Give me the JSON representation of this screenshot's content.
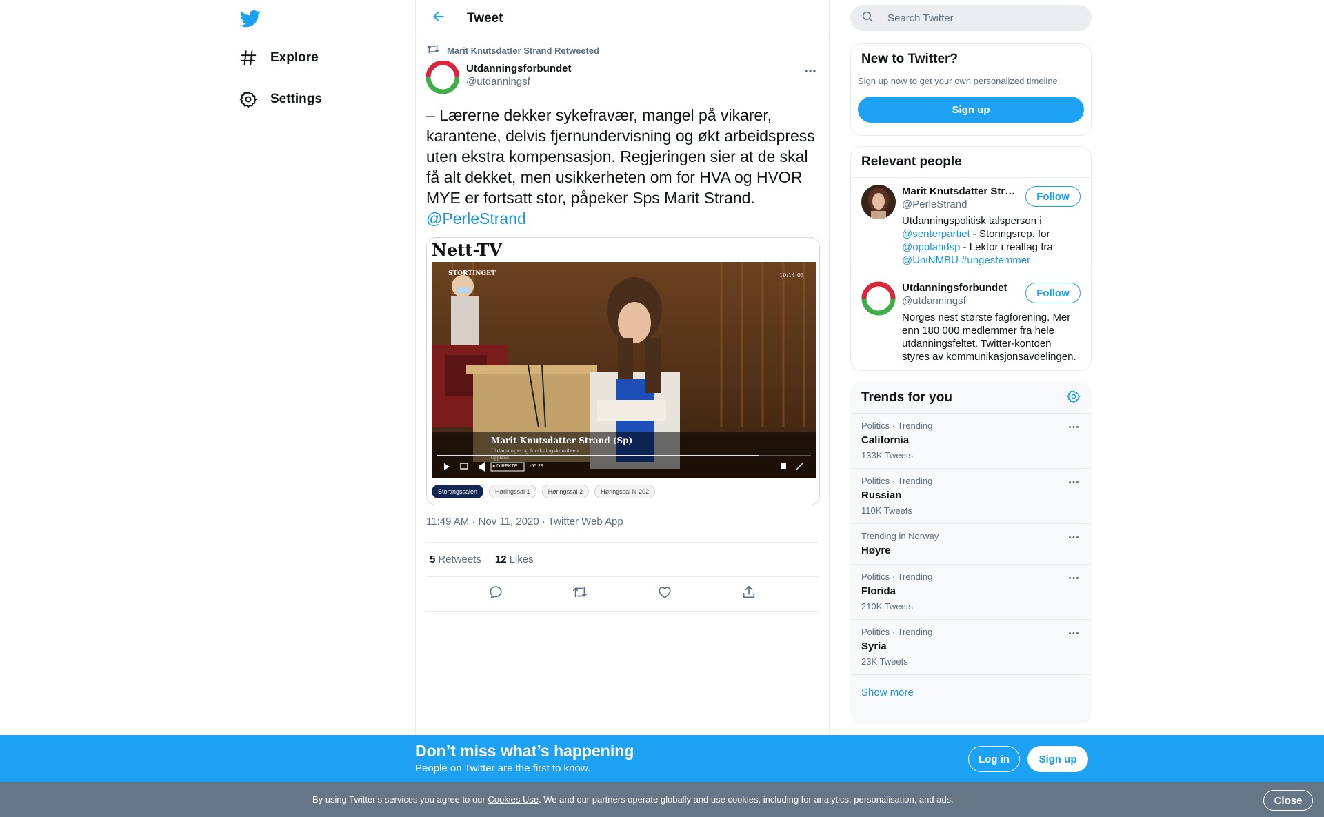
{
  "nav": {
    "logo_icon": "twitter-bird-icon",
    "items": [
      {
        "icon": "hashtag-icon",
        "label": "Explore"
      },
      {
        "icon": "gear-icon",
        "label": "Settings"
      }
    ]
  },
  "header": {
    "back_icon": "arrow-left-icon",
    "title": "Tweet"
  },
  "tweet": {
    "retweet_label": "Marit Knutsdatter Strand Retweeted",
    "author_name": "Utdanningsforbundet",
    "author_handle": "@utdanningsf",
    "text": "– Lærerne dekker sykefravær, mangel på vikarer, karantene, delvis fjernundervisning og økt arbeidspress uten ekstra kompensasjon. Regjeringen sier at de skal få alt dekket, men usikkerheten om for HVA og HVOR MYE er fortsatt stor, påpeker Sps Marit Strand.",
    "mention": "@PerleStrand",
    "media": {
      "header": "Nett-TV",
      "video_logo": "STORTINGET",
      "video_clock": "10:14:03",
      "lower_third_name": "Marit Knutsdatter Strand (Sp)",
      "lower_third_sub": "Utdannings- og forskningskomiteen",
      "lower_third_sub2": "Oppland",
      "live_label": "● DIREKTE",
      "live_time": "-55:29",
      "tabs": [
        "Stortingssalen",
        "Høringssal 1",
        "Høringssal 2",
        "Høringssal N-202"
      ]
    },
    "time": "11:49 AM · Nov 11, 2020",
    "separator": "·",
    "source": "Twitter Web App",
    "retweets_count": "5",
    "retweets_label": "Retweets",
    "likes_count": "12",
    "likes_label": "Likes"
  },
  "search": {
    "placeholder": "Search Twitter"
  },
  "new_card": {
    "title": "New to Twitter?",
    "subtitle": "Sign up now to get your own personalized timeline!",
    "signup_label": "Sign up"
  },
  "relevant": {
    "title": "Relevant people",
    "people": [
      {
        "name": "Marit Knutsdatter Strand",
        "handle": "@PerleStrand",
        "follow_label": "Follow",
        "bio_parts": [
          "Utdanningspolitisk talsperson i ",
          "@senterpartiet",
          " - Storingsrep. for ",
          "@opplandsp",
          " - Lektor i realfag fra ",
          "@UniNMBU",
          " ",
          "#ungestemmer"
        ]
      },
      {
        "name": "Utdanningsforbundet",
        "handle": "@utdanningsf",
        "follow_label": "Follow",
        "bio": "Norges nest største fagforening. Mer enn 180 000 medlemmer fra hele utdanningsfeltet. Twitter-kontoen styres av kommunikasjonsavdelingen."
      }
    ]
  },
  "trends": {
    "title": "Trends for you",
    "settings_icon": "gear-icon",
    "items": [
      {
        "context": "Politics · Trending",
        "name": "California",
        "count": "133K Tweets"
      },
      {
        "context": "Politics · Trending",
        "name": "Russian",
        "count": "110K Tweets"
      },
      {
        "context": "Trending in Norway",
        "name": "Høyre",
        "count": ""
      },
      {
        "context": "Politics · Trending",
        "name": "Florida",
        "count": "210K Tweets"
      },
      {
        "context": "Politics · Trending",
        "name": "Syria",
        "count": "23K Tweets"
      }
    ],
    "show_more": "Show more"
  },
  "promo": {
    "title": "Don’t miss what’s happening",
    "subtitle": "People on Twitter are the first to know.",
    "login_label": "Log in",
    "signup_label": "Sign up"
  },
  "cookie": {
    "text_before": "By using Twitter’s services you agree to our ",
    "link": "Cookies Use",
    "text_after": ". We and our partners operate globally and use cookies, including for analytics, personalisation, and ads.",
    "close_label": "Close"
  },
  "colors": {
    "accent": "#1da1f2",
    "link": "#1b95e0",
    "muted": "#5b7083",
    "cookie_bg": "#657786"
  }
}
